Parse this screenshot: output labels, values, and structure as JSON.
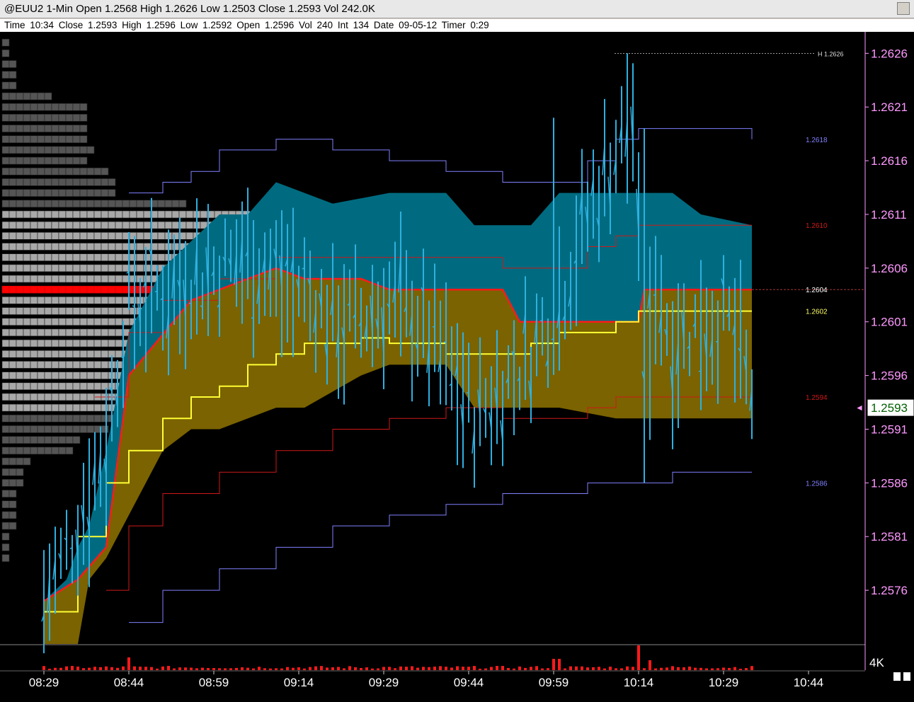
{
  "header": {
    "title": "@EUU2 1-Min  Open 1.2568  High 1.2626  Low 1.2503  Close 1.2593  Vol 242.0K",
    "info": "Time 10:34   Close 1.2593   High 1.2596   Low 1.2592   Open 1.2596   Vol 240   Int 134   Date 09-05-12   Timer 0:29"
  },
  "colors": {
    "background": "#000000",
    "price_bars": "#2fb0e0",
    "vwap": "#ffff33",
    "value_area_upper": "#006b80",
    "value_area_lower": "#7a6300",
    "value_area_edge": "#ff1a1a",
    "band_inner": "#d01818",
    "band_outer": "#8080ff",
    "volume": "#ff1a1a",
    "axis_text": "#ff99ff",
    "profile_light": "#a8a8a8",
    "profile_dark": "#555555",
    "poc": "#ff0000"
  },
  "chart_data": {
    "type": "line",
    "symbol": "@EUU2",
    "interval": "1-Min",
    "ylim": [
      1.2571,
      1.2628
    ],
    "y_ticks": [
      "1.2626",
      "1.2621",
      "1.2616",
      "1.2611",
      "1.2606",
      "1.2601",
      "1.2596",
      "1.2591",
      "1.2586",
      "1.2581",
      "1.2576"
    ],
    "x_ticks": [
      "08:29",
      "08:44",
      "08:59",
      "09:14",
      "09:29",
      "09:44",
      "09:59",
      "10:14",
      "10:29",
      "10:44"
    ],
    "last_price": "1.2593",
    "high_marker": "H 1.2626",
    "line_labels": [
      {
        "text": "1.2618",
        "value": 1.2618,
        "color": "#8080ff"
      },
      {
        "text": "1.2610",
        "value": 1.261,
        "color": "#d01818"
      },
      {
        "text": "1.2604",
        "value": 1.2604,
        "color": "#ffffff"
      },
      {
        "text": "1.2602",
        "value": 1.2602,
        "color": "#ffff66"
      },
      {
        "text": "1.2594",
        "value": 1.2594,
        "color": "#d01818"
      },
      {
        "text": "1.2586",
        "value": 1.2586,
        "color": "#8080ff"
      }
    ],
    "volume_axis_label": "4K",
    "series": [
      {
        "name": "vwap",
        "x": [
          "08:29",
          "08:35",
          "08:40",
          "08:44",
          "08:50",
          "08:55",
          "09:00",
          "09:05",
          "09:10",
          "09:15",
          "09:20",
          "09:25",
          "09:30",
          "09:35",
          "09:40",
          "09:45",
          "09:50",
          "09:55",
          "10:00",
          "10:05",
          "10:10",
          "10:14",
          "10:20",
          "10:25",
          "10:30",
          "10:34"
        ],
        "values": [
          1.2574,
          1.2581,
          1.2586,
          1.2589,
          1.2592,
          1.2594,
          1.2595,
          1.2597,
          1.2598,
          1.2599,
          1.2599,
          1.25995,
          1.2599,
          1.2599,
          1.2598,
          1.2598,
          1.2598,
          1.2599,
          1.26,
          1.26,
          1.2601,
          1.2602,
          1.2602,
          1.2602,
          1.2602,
          1.2602
        ]
      },
      {
        "name": "upper_band_inner",
        "x": [
          "08:38",
          "08:44",
          "08:50",
          "09:00",
          "09:10",
          "09:20",
          "09:30",
          "09:40",
          "09:50",
          "10:00",
          "10:05",
          "10:10",
          "10:14",
          "10:20",
          "10:25",
          "10:34"
        ],
        "values": [
          1.2594,
          1.26,
          1.2603,
          1.2605,
          1.2607,
          1.2607,
          1.2607,
          1.2607,
          1.2606,
          1.2606,
          1.2608,
          1.2609,
          1.261,
          1.261,
          1.261,
          1.261
        ]
      },
      {
        "name": "lower_band_inner",
        "x": [
          "08:40",
          "08:44",
          "08:50",
          "09:00",
          "09:10",
          "09:20",
          "09:30",
          "09:40",
          "09:50",
          "10:00",
          "10:05",
          "10:10",
          "10:14",
          "10:20",
          "10:34"
        ],
        "values": [
          1.2576,
          1.2582,
          1.2585,
          1.2587,
          1.2589,
          1.2591,
          1.2592,
          1.2593,
          1.2592,
          1.2592,
          1.2593,
          1.2594,
          1.2594,
          1.2594,
          1.2594
        ]
      },
      {
        "name": "upper_band_outer",
        "x": [
          "08:44",
          "08:50",
          "08:55",
          "09:00",
          "09:05",
          "09:10",
          "09:20",
          "09:30",
          "09:40",
          "09:50",
          "10:00",
          "10:05",
          "10:10",
          "10:14",
          "10:20",
          "10:34"
        ],
        "values": [
          1.2613,
          1.2614,
          1.2615,
          1.2617,
          1.2617,
          1.2618,
          1.2617,
          1.2616,
          1.2615,
          1.2614,
          1.2614,
          1.2616,
          1.2618,
          1.2619,
          1.2619,
          1.2618
        ]
      },
      {
        "name": "lower_band_outer",
        "x": [
          "08:44",
          "08:50",
          "09:00",
          "09:10",
          "09:20",
          "09:30",
          "09:40",
          "09:50",
          "10:00",
          "10:05",
          "10:10",
          "10:14",
          "10:20",
          "10:34"
        ],
        "values": [
          1.2573,
          1.2576,
          1.2578,
          1.258,
          1.2582,
          1.2583,
          1.2584,
          1.2585,
          1.2585,
          1.2586,
          1.2586,
          1.2586,
          1.2587,
          1.2587
        ]
      }
    ],
    "grid": false
  }
}
